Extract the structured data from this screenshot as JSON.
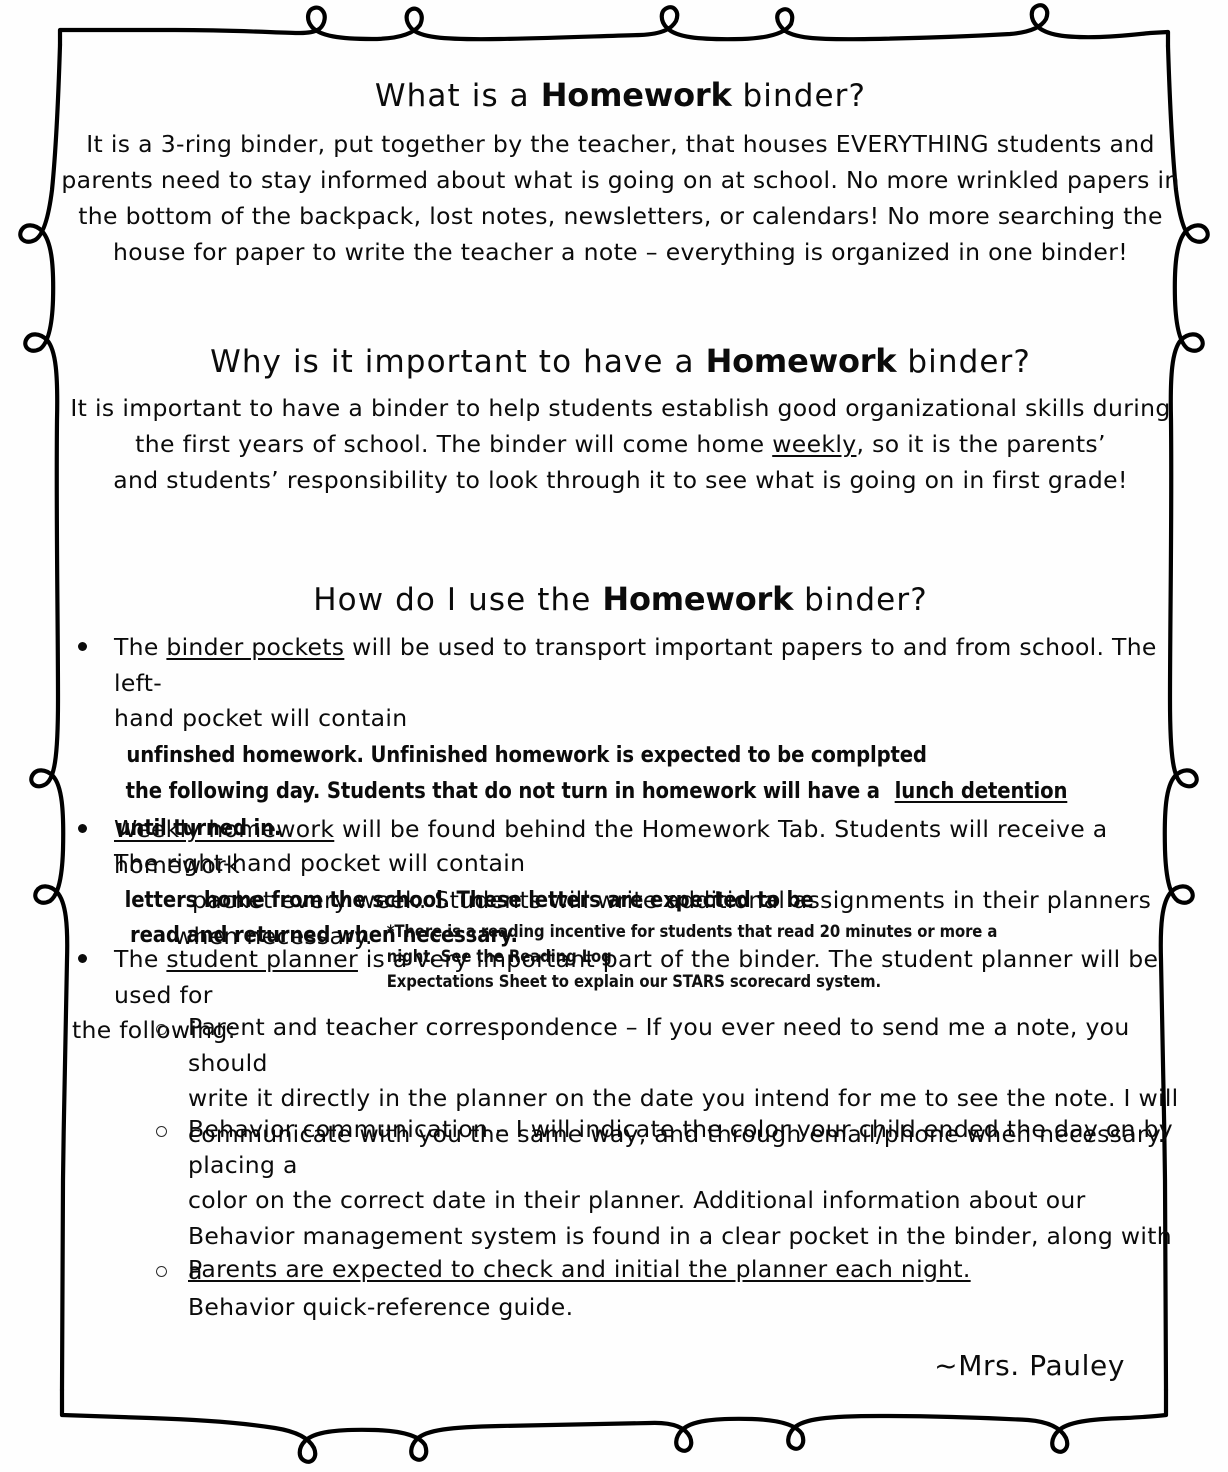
{
  "document": {
    "type": "parent-handout",
    "signature": "~Mrs. Pauley"
  },
  "sections": [
    {
      "id": "what",
      "title_before": "What is a ",
      "title_keyword": "Homework",
      "title_after": " binder?",
      "paragraph_lines": [
        "It is a 3-ring binder, put together by the teacher, that houses EVERYTHING students and",
        "parents need to stay informed about what is going on at school.  No more wrinkled papers in",
        "the bottom of the backpack, lost notes, newsletters, or calendars! No more searching the",
        "house for paper to write the teacher a note – everything is  organized in one binder!"
      ]
    },
    {
      "id": "why",
      "title_before": "Why is it important to have a   ",
      "title_keyword": "Homework",
      "title_after": " binder?",
      "paragraph_line_1": "It is important to have a  binder to help students establish good organizational skills during",
      "paragraph_line_2_a": "the first years of school.  The binder will come home ",
      "paragraph_line_2_underlined": "weekly",
      "paragraph_line_2_b": ", so it is the parents’",
      "paragraph_line_3": "and students’ responsibility to look through it  to see what is going  on in first grade!"
    },
    {
      "id": "how",
      "title_before": "How do I use the  ",
      "title_keyword": "Homework",
      "title_after": " binder?"
    }
  ],
  "bullets": [
    {
      "id": "binder-pockets",
      "marker": "disc",
      "line1_a": "The ",
      "line1_underlined": "binder pockets",
      "line1_b": " will be used to transport important papers to and from school.  The left-",
      "line2_a": "hand pocket will contain ",
      "line2_alt": "unfinshed homework.  Unfinished homework is expected to be complpted",
      "line3_alt": "the following day.  Students that do not turn in homework will have a ",
      "line3_alt_underlined": "lunch detention",
      "line3_alt_b": " until turned in.",
      "line4_a": "The right-hand pocket will contain ",
      "line4_alt": "letters home from the school.  These letters are expected to be",
      "line5_alt": "read and returned when necessary."
    },
    {
      "id": "weekly-homework",
      "marker": "disc",
      "line1_underlined": "Weekly homework",
      "line1_b": " will be found behind the Homework Tab.  Students will receive a homework",
      "line2": "packet every week. Students will write additional assignments in their planners",
      "line3": "when necessary.",
      "footnote_line1": "*There is a reading incentive for students that read 20 minutes or more a night.  See the Reading Log",
      "footnote_line2": "Expectations Sheet to explain our STARS scorecard system."
    },
    {
      "id": "student-planner",
      "marker": "disc",
      "line1_a": "The ",
      "line1_underlined": "student planner",
      "line1_b": " is a very important part of the binder.  The student planner will be used for",
      "line2": "the following:"
    }
  ],
  "sub_bullets": [
    {
      "id": "parent-teacher-correspondence",
      "marker": "circle",
      "lines": [
        "Parent and teacher correspondence – If you ever need to send me a note, you should",
        "write it directly in the planner on the date you intend for me to see the note.  I will",
        "communicate with you the same way, and through email/phone when necessary."
      ]
    },
    {
      "id": "behavior-communication",
      "marker": "circle",
      "lines": [
        "Behavior communication – I will indicate the color your child ended the day on by placing a",
        "color on the correct date in their planner.  Additional information about our",
        "Behavior management system is found in a clear pocket in the binder, along with a",
        "Behavior quick-reference guide."
      ]
    },
    {
      "id": "parents-initial-planner",
      "marker": "circle",
      "underlined_text": "Parents are expected to check and initial the planner each night."
    }
  ],
  "colors": {
    "ink": "#0b0b0b",
    "page": "#fefefe",
    "border": "#000000"
  }
}
